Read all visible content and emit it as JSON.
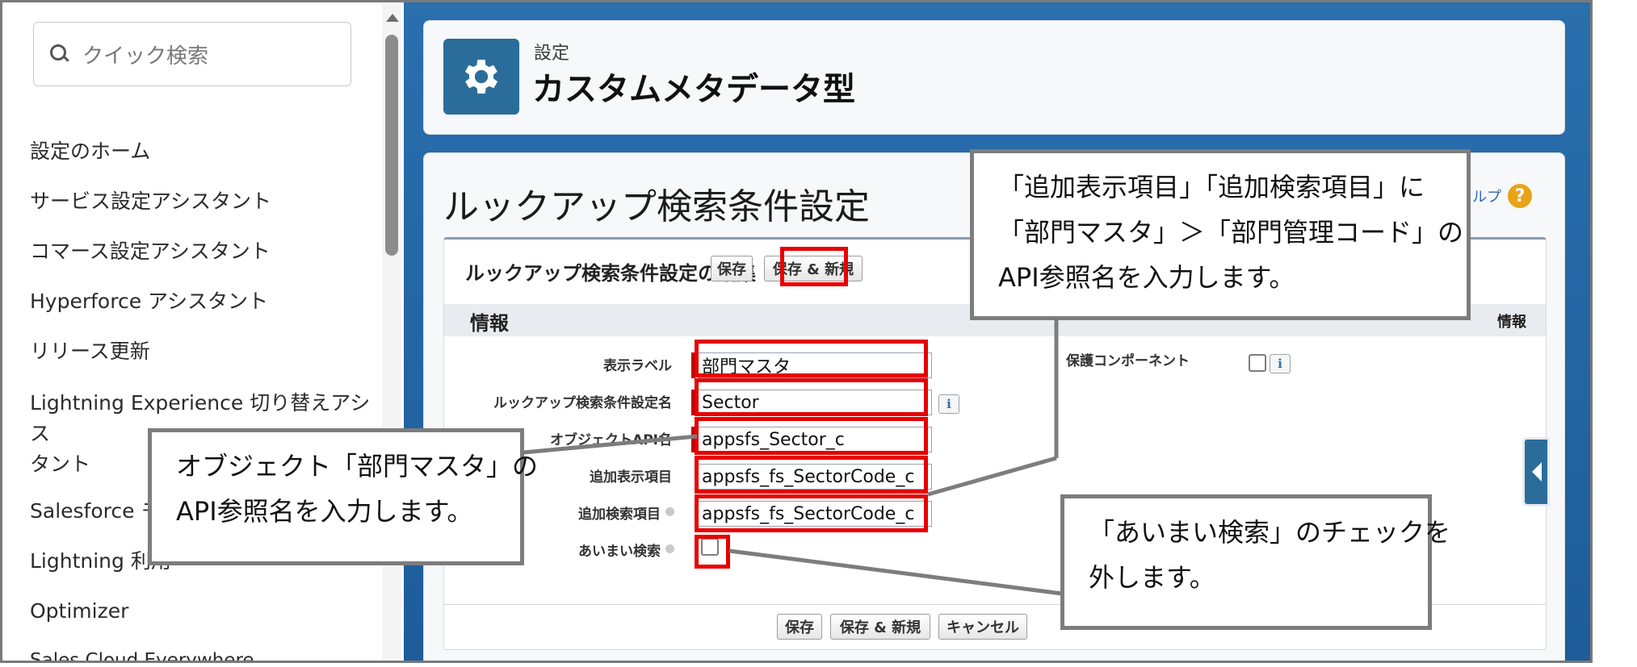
{
  "sidebar": {
    "search_placeholder": "クイック検索",
    "items": [
      "設定のホーム",
      "サービス設定アシスタント",
      "コマース設定アシスタント",
      "Hyperforce アシスタント",
      "リリース更新",
      "Lightning Experience 切り替えアシス",
      "タント",
      "Salesforce モ",
      "Lightning 利用",
      "Optimizer",
      "Sales Cloud Everywhere"
    ]
  },
  "header": {
    "breadcrumb": "設定",
    "title": "カスタムメタデータ型",
    "icon": "gear-icon"
  },
  "page": {
    "title": "ルックアップ検索条件設定",
    "help_text": "ルプ",
    "help_icon": "?"
  },
  "form": {
    "title": "ルックアップ検索条件設定の編集",
    "buttons": {
      "save": "保存",
      "save_new": "保存 & 新規",
      "cancel": "キャンセル"
    },
    "section": "情報",
    "section_right": "情報",
    "fields": {
      "label": {
        "label": "表示ラベル",
        "value": "部門マスタ"
      },
      "name": {
        "label": "ルックアップ検索条件設定名",
        "value": "Sector"
      },
      "object_api": {
        "label": "オブジェクトAPI名",
        "value": "appsfs_Sector_c"
      },
      "display_field": {
        "label": "追加表示項目",
        "value": "appsfs_fs_SectorCode_c"
      },
      "search_field": {
        "label": "追加検索項目",
        "value": "appsfs_fs_SectorCode_c"
      },
      "fuzzy": {
        "label": "あいまい検索",
        "checked": false
      },
      "protected": {
        "label": "保護コンポーネント",
        "checked": false
      }
    },
    "info_glyph": "i"
  },
  "callouts": {
    "top": [
      "「追加表示項目」「追加検索項目」に",
      "「部門マスタ」＞「部門管理コード」の",
      "API参照名を入力します。"
    ],
    "left": [
      "オブジェクト「部門マスタ」の",
      "API参照名を入力します。"
    ],
    "bottom": [
      "「あいまい検索」のチェックを",
      "外します。"
    ]
  },
  "colors": {
    "highlight": "#e60000",
    "brand": "#2b6d9a",
    "callout_border": "#7d7d7d"
  }
}
